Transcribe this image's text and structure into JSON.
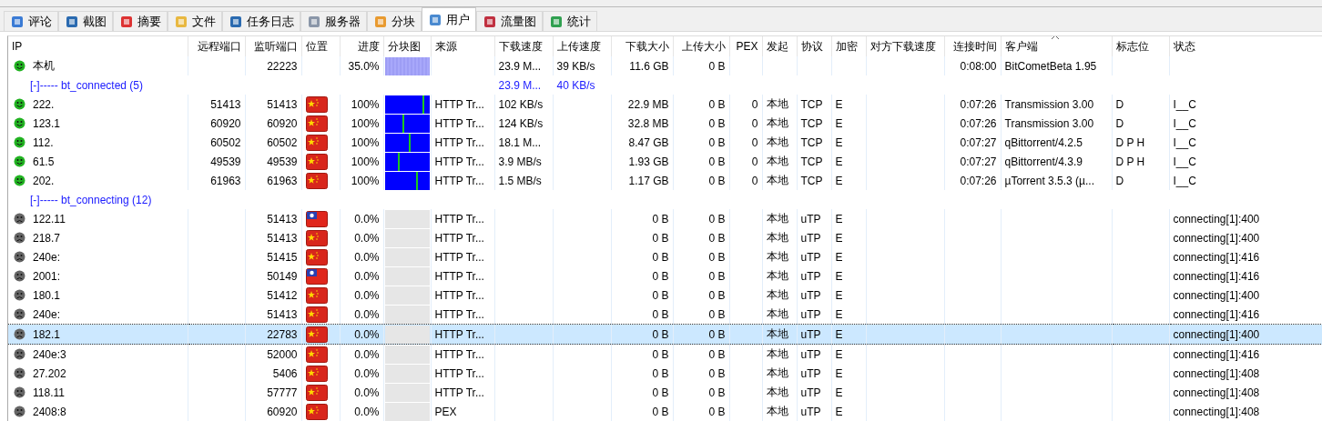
{
  "tabs": [
    {
      "label": "评论",
      "selected": false
    },
    {
      "label": "截图",
      "selected": false
    },
    {
      "label": "摘要",
      "selected": false
    },
    {
      "label": "文件",
      "selected": false
    },
    {
      "label": "任务日志",
      "selected": false
    },
    {
      "label": "服务器",
      "selected": false
    },
    {
      "label": "分块",
      "selected": false
    },
    {
      "label": "用户",
      "selected": true
    },
    {
      "label": "流量图",
      "selected": false
    },
    {
      "label": "统计",
      "selected": false
    }
  ],
  "columns": [
    {
      "label": "IP",
      "sorted": false
    },
    {
      "label": "远程端口",
      "sorted": false
    },
    {
      "label": "监听端口",
      "sorted": false
    },
    {
      "label": "位置",
      "sorted": false
    },
    {
      "label": "进度",
      "sorted": false
    },
    {
      "label": "分块图",
      "sorted": false
    },
    {
      "label": "来源",
      "sorted": false
    },
    {
      "label": "下载速度",
      "sorted": false
    },
    {
      "label": "上传速度",
      "sorted": false
    },
    {
      "label": "下载大小",
      "sorted": false
    },
    {
      "label": "上传大小",
      "sorted": false
    },
    {
      "label": "PEX",
      "sorted": false
    },
    {
      "label": "发起",
      "sorted": false
    },
    {
      "label": "协议",
      "sorted": false
    },
    {
      "label": "加密",
      "sorted": false
    },
    {
      "label": "对方下载速度",
      "sorted": false
    },
    {
      "label": "连接时间",
      "sorted": false
    },
    {
      "label": "客户端",
      "sorted": true
    },
    {
      "label": "标志位",
      "sorted": false
    },
    {
      "label": "状态",
      "sorted": false
    }
  ],
  "rows": [
    {
      "kind": "local",
      "selected": false,
      "connected": true,
      "ip": "本机",
      "listen_port": "22223",
      "progress": "35.0%",
      "download_speed": "23.9 M...",
      "upload_speed": "39 KB/s",
      "downloaded": "11.6 GB",
      "uploaded": "0 B",
      "connect_time": "0:08:00",
      "client": "BitCometBeta 1.95"
    },
    {
      "kind": "group",
      "selected": false,
      "ip": "[-]----- bt_connected (5)",
      "download_speed": "23.9 M...",
      "upload_speed": "40 KB/s"
    },
    {
      "kind": "peer",
      "selected": false,
      "connected": true,
      "location": {
        "kind": "cn"
      },
      "ip": "222.",
      "remote_port": "51413",
      "listen_port": "51413",
      "progress": "100%",
      "source": "HTTP Tr...",
      "download_speed": "102 KB/s",
      "downloaded": "22.9 MB",
      "uploaded": "0 B",
      "pex": "0",
      "initiated": "本地",
      "protocol": "TCP",
      "encryption": "E",
      "connect_time": "0:07:26",
      "client": "Transmission 3.00",
      "flags": "D",
      "status": "I__C"
    },
    {
      "kind": "peer",
      "selected": false,
      "connected": true,
      "location": {
        "kind": "cn"
      },
      "ip": "123.1",
      "remote_port": "60920",
      "listen_port": "60920",
      "progress": "100%",
      "source": "HTTP Tr...",
      "download_speed": "124 KB/s",
      "downloaded": "32.8 MB",
      "uploaded": "0 B",
      "pex": "0",
      "initiated": "本地",
      "protocol": "TCP",
      "encryption": "E",
      "connect_time": "0:07:26",
      "client": "Transmission 3.00",
      "flags": "D",
      "status": "I__C"
    },
    {
      "kind": "peer",
      "selected": false,
      "connected": true,
      "location": {
        "kind": "cn"
      },
      "ip": "112.",
      "remote_port": "60502",
      "listen_port": "60502",
      "progress": "100%",
      "source": "HTTP Tr...",
      "download_speed": "18.1 M...",
      "downloaded": "8.47 GB",
      "uploaded": "0 B",
      "pex": "0",
      "initiated": "本地",
      "protocol": "TCP",
      "encryption": "E",
      "connect_time": "0:07:27",
      "client": "qBittorrent/4.2.5",
      "flags": "D P H",
      "status": "I__C"
    },
    {
      "kind": "peer",
      "selected": false,
      "connected": true,
      "location": {
        "kind": "cn"
      },
      "ip": "61.5",
      "remote_port": "49539",
      "listen_port": "49539",
      "progress": "100%",
      "source": "HTTP Tr...",
      "download_speed": "3.9 MB/s",
      "downloaded": "1.93 GB",
      "uploaded": "0 B",
      "pex": "0",
      "initiated": "本地",
      "protocol": "TCP",
      "encryption": "E",
      "connect_time": "0:07:27",
      "client": "qBittorrent/4.3.9",
      "flags": "D P H",
      "status": "I__C"
    },
    {
      "kind": "peer",
      "selected": false,
      "connected": true,
      "location": {
        "kind": "cn"
      },
      "ip": "202.",
      "remote_port": "61963",
      "listen_port": "61963",
      "progress": "100%",
      "source": "HTTP Tr...",
      "download_speed": "1.5 MB/s",
      "downloaded": "1.17 GB",
      "uploaded": "0 B",
      "pex": "0",
      "initiated": "本地",
      "protocol": "TCP",
      "encryption": "E",
      "connect_time": "0:07:26",
      "client": "µTorrent 3.5.3 (µ...",
      "flags": "D",
      "status": "I__C"
    },
    {
      "kind": "group",
      "selected": false,
      "ip": "[-]----- bt_connecting (12)"
    },
    {
      "kind": "peer",
      "selected": false,
      "connected": false,
      "location": {
        "kind": "tw"
      },
      "ip": "122.11",
      "listen_port": "51413",
      "progress": "0.0%",
      "source": "HTTP Tr...",
      "downloaded": "0 B",
      "uploaded": "0 B",
      "initiated": "本地",
      "protocol": "uTP",
      "encryption": "E",
      "status": "connecting[1]:400"
    },
    {
      "kind": "peer",
      "selected": false,
      "connected": false,
      "location": {
        "kind": "cn"
      },
      "ip": "218.7",
      "listen_port": "51413",
      "progress": "0.0%",
      "source": "HTTP Tr...",
      "downloaded": "0 B",
      "uploaded": "0 B",
      "initiated": "本地",
      "protocol": "uTP",
      "encryption": "E",
      "status": "connecting[1]:400"
    },
    {
      "kind": "peer",
      "selected": false,
      "connected": false,
      "location": {
        "kind": "cn"
      },
      "ip": "240e:",
      "listen_port": "51415",
      "progress": "0.0%",
      "source": "HTTP Tr...",
      "downloaded": "0 B",
      "uploaded": "0 B",
      "initiated": "本地",
      "protocol": "uTP",
      "encryption": "E",
      "status": "connecting[1]:416"
    },
    {
      "kind": "peer",
      "selected": false,
      "connected": false,
      "location": {
        "kind": "tw"
      },
      "ip": "2001:",
      "listen_port": "50149",
      "progress": "0.0%",
      "source": "HTTP Tr...",
      "downloaded": "0 B",
      "uploaded": "0 B",
      "initiated": "本地",
      "protocol": "uTP",
      "encryption": "E",
      "status": "connecting[1]:416"
    },
    {
      "kind": "peer",
      "selected": false,
      "connected": false,
      "location": {
        "kind": "cn"
      },
      "ip": "180.1",
      "listen_port": "51412",
      "progress": "0.0%",
      "source": "HTTP Tr...",
      "downloaded": "0 B",
      "uploaded": "0 B",
      "initiated": "本地",
      "protocol": "uTP",
      "encryption": "E",
      "status": "connecting[1]:400"
    },
    {
      "kind": "peer",
      "selected": false,
      "connected": false,
      "location": {
        "kind": "cn"
      },
      "ip": "240e:",
      "listen_port": "51413",
      "progress": "0.0%",
      "source": "HTTP Tr...",
      "downloaded": "0 B",
      "uploaded": "0 B",
      "initiated": "本地",
      "protocol": "uTP",
      "encryption": "E",
      "status": "connecting[1]:416"
    },
    {
      "kind": "peer",
      "selected": true,
      "connected": false,
      "location": {
        "kind": "cn"
      },
      "ip": "182.1",
      "listen_port": "22783",
      "progress": "0.0%",
      "source": "HTTP Tr...",
      "downloaded": "0 B",
      "uploaded": "0 B",
      "initiated": "本地",
      "protocol": "uTP",
      "encryption": "E",
      "status": "connecting[1]:400"
    },
    {
      "kind": "peer",
      "selected": false,
      "connected": false,
      "location": {
        "kind": "cn"
      },
      "ip": "240e:3",
      "listen_port": "52000",
      "progress": "0.0%",
      "source": "HTTP Tr...",
      "downloaded": "0 B",
      "uploaded": "0 B",
      "initiated": "本地",
      "protocol": "uTP",
      "encryption": "E",
      "status": "connecting[1]:416"
    },
    {
      "kind": "peer",
      "selected": false,
      "connected": false,
      "location": {
        "kind": "cn"
      },
      "ip": "27.202",
      "listen_port": "5406",
      "progress": "0.0%",
      "source": "HTTP Tr...",
      "downloaded": "0 B",
      "uploaded": "0 B",
      "initiated": "本地",
      "protocol": "uTP",
      "encryption": "E",
      "status": "connecting[1]:408"
    },
    {
      "kind": "peer",
      "selected": false,
      "connected": false,
      "location": {
        "kind": "cn"
      },
      "ip": "118.11",
      "listen_port": "57777",
      "progress": "0.0%",
      "source": "HTTP Tr...",
      "downloaded": "0 B",
      "uploaded": "0 B",
      "initiated": "本地",
      "protocol": "uTP",
      "encryption": "E",
      "status": "connecting[1]:408"
    },
    {
      "kind": "peer",
      "selected": false,
      "connected": false,
      "location": {
        "kind": "cn"
      },
      "ip": "2408:8",
      "listen_port": "60920",
      "progress": "0.0%",
      "source": "PEX",
      "downloaded": "0 B",
      "uploaded": "0 B",
      "initiated": "本地",
      "protocol": "uTP",
      "encryption": "E",
      "status": "connecting[1]:408"
    }
  ]
}
